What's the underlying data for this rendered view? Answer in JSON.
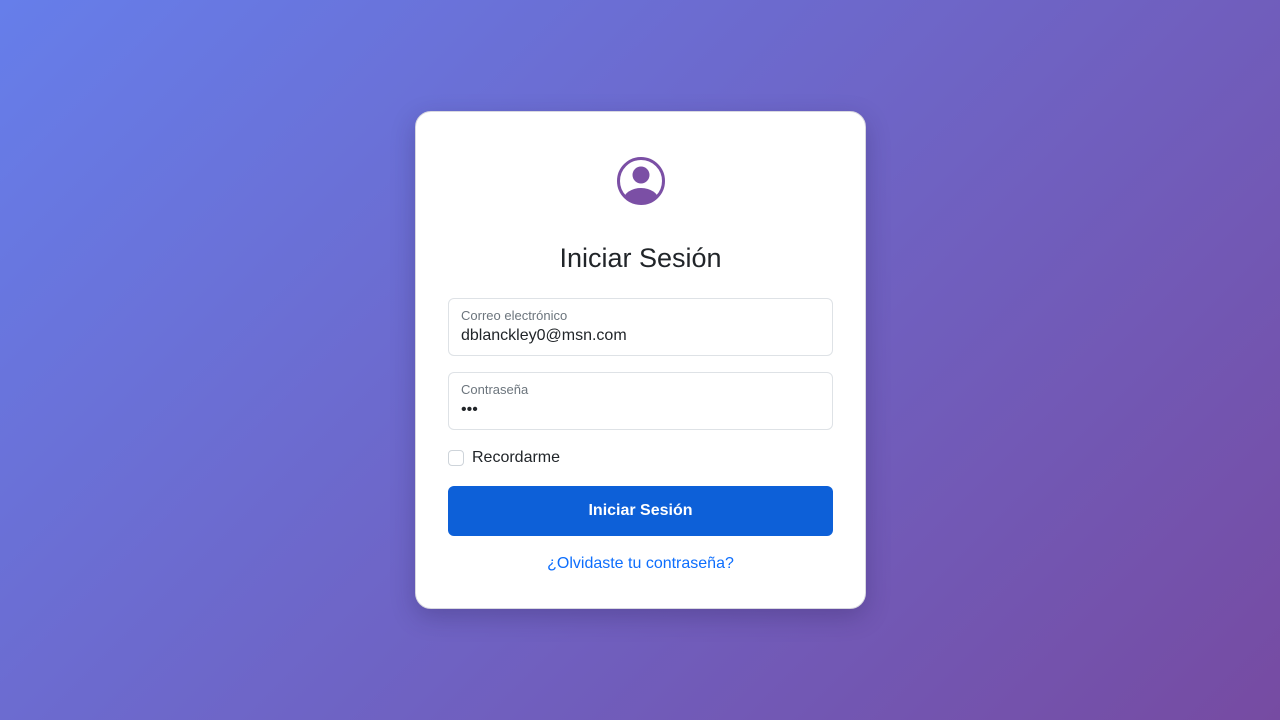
{
  "login": {
    "avatar_icon": "user-circle-icon",
    "title": "Iniciar Sesión",
    "email": {
      "label": "Correo electrónico",
      "value": "dblanckley0@msn.com"
    },
    "password": {
      "label": "Contraseña",
      "value": "•••"
    },
    "remember": {
      "label": "Recordarme",
      "checked": false
    },
    "submit_label": "Iniciar Sesión",
    "forgot_label": "¿Olvidaste tu contraseña?"
  },
  "colors": {
    "accent": "#764ba2",
    "primary_button": "#0d60d8",
    "link": "#0d6efd",
    "background_start": "#667eea",
    "background_end": "#764ba2"
  }
}
